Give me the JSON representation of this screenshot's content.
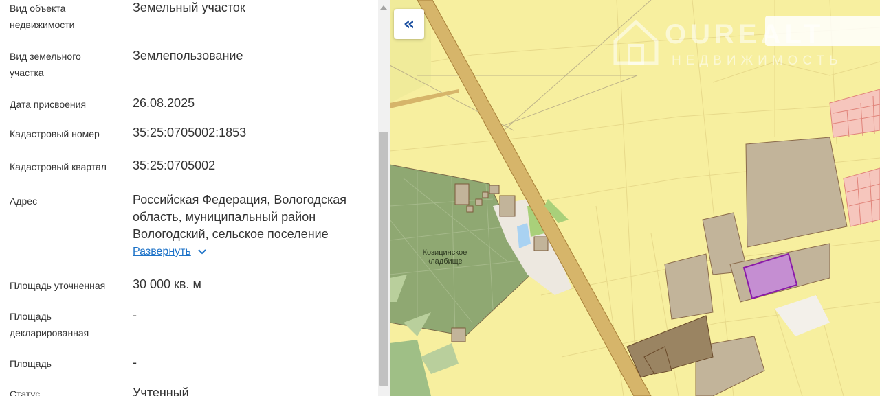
{
  "info": {
    "fields": [
      {
        "label": "Вид объекта недвижимости",
        "value": "Земельный участок"
      },
      {
        "label": "Вид земельного участка",
        "value": "Землепользование"
      },
      {
        "label": "Дата присвоения",
        "value": "26.08.2025"
      },
      {
        "label": "Кадастровый номер",
        "value": "35:25:0705002:1853"
      },
      {
        "label": "Кадастровый квартал",
        "value": "35:25:0705002"
      },
      {
        "label": "Адрес",
        "value": "Российская Федерация, Вологодская область, муниципальный район Вологодский, сельское поселение"
      },
      {
        "label": "Площадь уточненная",
        "value": "30 000 кв. м"
      },
      {
        "label": "Площадь декларированная",
        "value": "-"
      },
      {
        "label": "Площадь",
        "value": "-"
      },
      {
        "label": "Статус",
        "value": "Учтенный"
      }
    ],
    "expand_label": "Развернуть"
  },
  "map": {
    "collapse_glyph": "«",
    "watermark_name": "OUREALT",
    "watermark_sub": "НЕДВИЖИМОСТЬ",
    "cemetery_label": "Козицинское кладбище",
    "colors": {
      "background": "#f7ef9f",
      "road": "#d6b56a",
      "cemetery": "#8fa872",
      "built_parcel": "#c2b49a",
      "dark_parcel": "#9a8462",
      "selected_parcel": "#c58ed2",
      "selected_outline": "#8a1aa8",
      "residential": "#f6c6bd",
      "water": "#a9d2f2"
    },
    "icons": {
      "collapse": "double-chevron-left-icon",
      "watermark": "house-logo-icon",
      "expand": "chevron-down-icon"
    }
  }
}
